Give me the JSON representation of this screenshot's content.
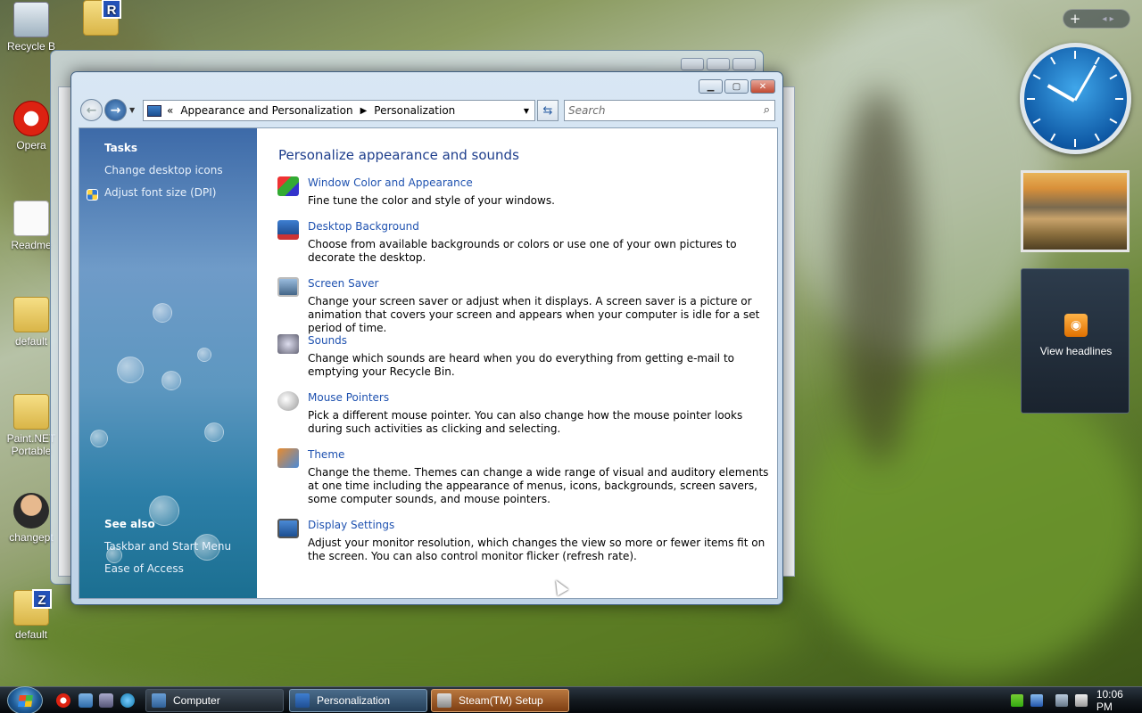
{
  "desktop": {
    "icons": [
      {
        "label": "Recycle B"
      },
      {
        "label": ""
      },
      {
        "label": "Opera"
      },
      {
        "label": "Readme"
      },
      {
        "label": "default"
      },
      {
        "label": "Paint.NET Portable"
      },
      {
        "label": "changept"
      },
      {
        "label": "default"
      }
    ],
    "folder_r_letter": "R",
    "folder_z_letter": "Z"
  },
  "window": {
    "address": {
      "crumbs": [
        "Appearance and Personalization",
        "Personalization"
      ],
      "overflow": "«"
    },
    "search": {
      "placeholder": "Search"
    },
    "sidebar": {
      "tasks_heading": "Tasks",
      "tasks": [
        "Change desktop icons",
        "Adjust font size (DPI)"
      ],
      "see_also_heading": "See also",
      "see_also": [
        "Taskbar and Start Menu",
        "Ease of Access"
      ]
    },
    "main": {
      "title": "Personalize appearance and sounds",
      "items": [
        {
          "link": "Window Color and Appearance",
          "desc": "Fine tune the color and style of your windows.",
          "icon": "window-color-icon"
        },
        {
          "link": "Desktop Background",
          "desc": "Choose from available backgrounds or colors or use one of your own pictures to decorate the desktop.",
          "icon": "desktop-background-icon"
        },
        {
          "link": "Screen Saver",
          "desc": "Change your screen saver or adjust when it displays. A screen saver is a picture or animation that covers your screen and appears when your computer is idle for a set period of time.",
          "icon": "screen-saver-icon"
        },
        {
          "link": "Sounds",
          "desc": "Change which sounds are heard when you do everything from getting e-mail to emptying your Recycle Bin.",
          "icon": "sounds-icon"
        },
        {
          "link": "Mouse Pointers",
          "desc": "Pick a different mouse pointer. You can also change how the mouse pointer looks during such activities as clicking and selecting.",
          "icon": "mouse-pointers-icon"
        },
        {
          "link": "Theme",
          "desc": "Change the theme. Themes can change a wide range of visual and auditory elements at one time including the appearance of menus, icons, backgrounds, screen savers, some computer sounds, and mouse pointers.",
          "icon": "theme-icon"
        },
        {
          "link": "Display Settings",
          "desc": "Adjust your monitor resolution, which changes the view so more or fewer items fit on the screen. You can also control monitor flicker (refresh rate).",
          "icon": "display-settings-icon"
        }
      ]
    }
  },
  "gadgets": {
    "bar_plus": "+",
    "bar_arrows": "◂ ▸",
    "feed_text": "View headlines"
  },
  "taskbar": {
    "buttons": [
      {
        "label": "Computer"
      },
      {
        "label": "Personalization"
      },
      {
        "label": "Steam(TM) Setup"
      }
    ],
    "time": "10:06 PM"
  },
  "colors": {
    "link": "#1f52b0",
    "title": "#1e3e8c",
    "taskbar": "#141a20"
  }
}
